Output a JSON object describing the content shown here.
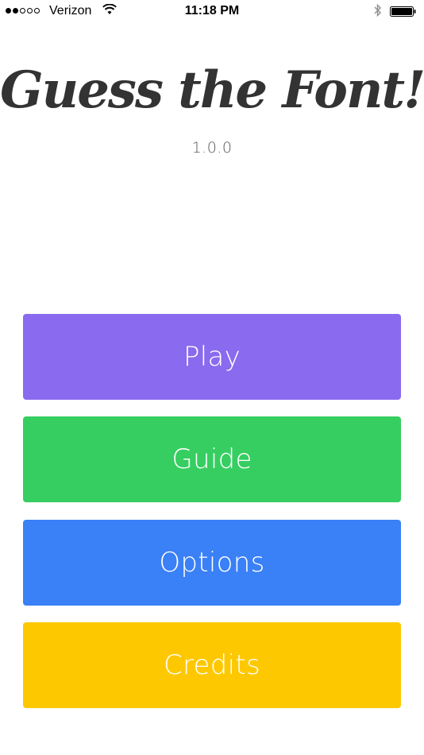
{
  "status_bar": {
    "carrier": "Verizon",
    "time": "11:18 PM",
    "signal_icon": "signal-dots-icon",
    "wifi_icon": "wifi-icon",
    "bluetooth_icon": "bluetooth-icon",
    "battery_icon": "battery-icon"
  },
  "header": {
    "title": "Guess the Font!",
    "version": "1.0.0",
    "title_color": "#333333"
  },
  "menu": {
    "play": {
      "label": "Play",
      "color": "#8A6AEE"
    },
    "guide": {
      "label": "Guide",
      "color": "#36CE61"
    },
    "options": {
      "label": "Options",
      "color": "#3A80F6"
    },
    "credits": {
      "label": "Credits",
      "color": "#FEC800"
    }
  }
}
